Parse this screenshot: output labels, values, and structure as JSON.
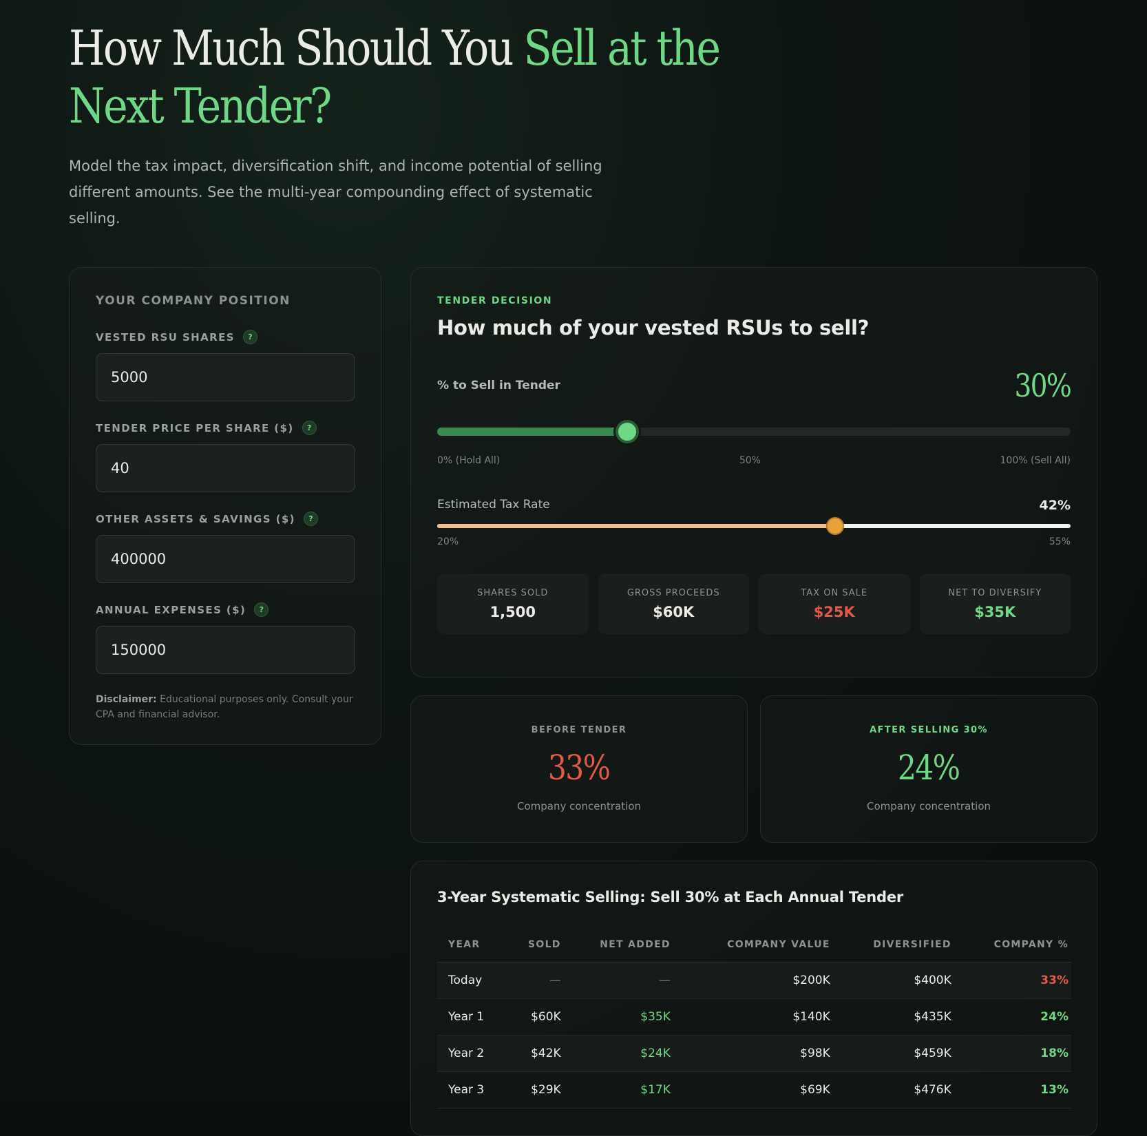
{
  "hero": {
    "title_main": "How Much Should You ",
    "title_accent": "Sell at the Next Tender?",
    "subtitle": "Model the tax impact, diversification shift, and income potential of selling different amounts. See the multi-year compounding effect of systematic selling."
  },
  "position_panel": {
    "title": "YOUR COMPANY POSITION",
    "fields": [
      {
        "label": "VESTED RSU SHARES",
        "value": "5000"
      },
      {
        "label": "TENDER PRICE PER SHARE ($)",
        "value": "40"
      },
      {
        "label": "OTHER ASSETS & SAVINGS ($)",
        "value": "400000"
      },
      {
        "label": "ANNUAL EXPENSES ($)",
        "value": "150000"
      }
    ],
    "help_glyph": "?",
    "disclaimer_bold": "Disclaimer:",
    "disclaimer_text": " Educational purposes only. Consult your CPA and financial advisor."
  },
  "decision": {
    "tag": "TENDER DECISION",
    "heading": "How much of your vested RSUs to sell?",
    "sell_label": "% to Sell in Tender",
    "sell_value": "30%",
    "sell_fraction": 0.3,
    "sell_marks": [
      "0% (Hold All)",
      "50%",
      "100% (Sell All)"
    ],
    "tax_label": "Estimated Tax Rate",
    "tax_value": "42%",
    "tax_min": 20,
    "tax_max": 55,
    "tax_current": 42,
    "tax_marks": [
      "20%",
      "55%"
    ],
    "stats": [
      {
        "label": "SHARES SOLD",
        "value": "1,500",
        "tone": ""
      },
      {
        "label": "GROSS PROCEEDS",
        "value": "$60K",
        "tone": ""
      },
      {
        "label": "TAX ON SALE",
        "value": "$25K",
        "tone": "red"
      },
      {
        "label": "NET TO DIVERSIFY",
        "value": "$35K",
        "tone": "green"
      }
    ]
  },
  "concentration": {
    "before": {
      "label": "BEFORE TENDER",
      "value": "33%",
      "sub": "Company concentration"
    },
    "after": {
      "label": "AFTER SELLING 30%",
      "value": "24%",
      "sub": "Company concentration"
    }
  },
  "table": {
    "title": "3-Year Systematic Selling: Sell 30% at Each Annual Tender",
    "headers": [
      "YEAR",
      "SOLD",
      "NET ADDED",
      "COMPANY VALUE",
      "DIVERSIFIED",
      "COMPANY %"
    ],
    "rows": [
      [
        "Today",
        "—",
        "—",
        "$200K",
        "$400K",
        "33%"
      ],
      [
        "Year 1",
        "$60K",
        "$35K",
        "$140K",
        "$435K",
        "24%"
      ],
      [
        "Year 2",
        "$42K",
        "$24K",
        "$98K",
        "$459K",
        "18%"
      ],
      [
        "Year 3",
        "$29K",
        "$17K",
        "$69K",
        "$476K",
        "13%"
      ]
    ]
  },
  "colors": {
    "accent_green": "#6fd887",
    "alert_red": "#e25a45",
    "tax_orange": "#e8a23c",
    "background": "#0b100e"
  }
}
